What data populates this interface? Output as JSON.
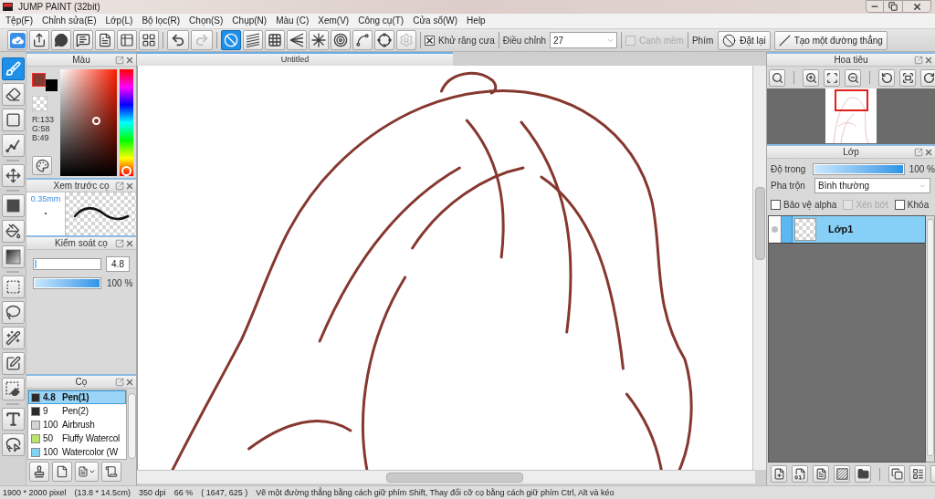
{
  "window": {
    "title": "JUMP PAINT (32bit)"
  },
  "menu": [
    "Tệp(F)",
    "Chỉnh sửa(E)",
    "Lớp(L)",
    "Bộ lọc(R)",
    "Chọn(S)",
    "Chụp(N)",
    "Màu (C)",
    "Xem(V)",
    "Công cụ(T)",
    "Cửa sổ(W)",
    "Help"
  ],
  "toolbar": {
    "history": [
      {
        "disabled": false
      },
      {
        "disabled": true
      }
    ],
    "rulers": [
      {
        "selected": true,
        "disabled": false
      },
      {
        "selected": false,
        "disabled": false
      },
      {
        "selected": false,
        "disabled": false
      },
      {
        "selected": false,
        "disabled": false
      },
      {
        "selected": false,
        "disabled": false
      },
      {
        "selected": false,
        "disabled": false
      },
      {
        "selected": false,
        "disabled": false
      },
      {
        "selected": false,
        "disabled": false
      },
      {
        "selected": false,
        "disabled": true
      }
    ],
    "antialias": {
      "label": "Khử răng cưa",
      "checked": true
    },
    "adjust": {
      "label": "Điều chỉnh",
      "value": "27"
    },
    "soft_edge": {
      "label": "Canh mềm",
      "checked": false,
      "disabled": true
    },
    "keys_label": "Phím",
    "buttons": [
      "Đặt lại",
      "Tạo một đường thẳng"
    ]
  },
  "tools": [
    {
      "selected": true
    },
    {
      "selected": false
    },
    {
      "selected": false
    },
    {
      "selected": false
    },
    {
      "selected": false
    },
    {
      "selected": false
    },
    {
      "selected": false
    },
    {
      "selected": false
    },
    {
      "selected": false
    },
    {
      "selected": false
    },
    {
      "selected": false
    },
    {
      "selected": false
    },
    {
      "selected": false
    },
    {
      "selected": false
    },
    {
      "selected": false
    }
  ],
  "color_panel": {
    "title": "Màu",
    "swatches": [
      {
        "kind": "background",
        "color": "#000000"
      },
      {
        "kind": "foreground",
        "color": "#853a31"
      }
    ],
    "readout": [
      "R:133",
      "G:58",
      "B:49"
    ],
    "hue_slider": {
      "level": 0.02
    }
  },
  "brush_preview": {
    "title": "Xem trước cọ",
    "size": "0.35mm"
  },
  "brush_control": {
    "title": "Kiểm soát cọ",
    "size": {
      "level": 0.03,
      "reading": "4.8"
    },
    "opacity": {
      "level": 1,
      "reading": "100 %"
    }
  },
  "brushes": {
    "title": "Cọ",
    "items": [
      {
        "size": "4.8",
        "name": "Pen(1)",
        "color": "#2b2b2b",
        "selected": true
      },
      {
        "size": "9",
        "name": "Pen(2)",
        "color": "#2b2b2b",
        "selected": false
      },
      {
        "size": "100",
        "name": "Airbrush",
        "color": "#d4d4d4",
        "selected": false
      },
      {
        "size": "50",
        "name": "Fluffy Watercol",
        "color": "#b8e36c",
        "selected": false
      },
      {
        "size": "100",
        "name": "Watercolor (W",
        "color": "#7fd4f2",
        "selected": false
      }
    ]
  },
  "document": {
    "tab": "Untitled"
  },
  "navigator": {
    "title": "Hoa tiêu"
  },
  "layers": {
    "title": "Lớp",
    "opacity": {
      "label": "Độ trong",
      "level": 1,
      "reading": "100 %"
    },
    "blend": {
      "label": "Pha trộn",
      "value": "Bình thường"
    },
    "options": [
      {
        "label": "Bảo vệ alpha",
        "checked": false,
        "disabled": false
      },
      {
        "label": "Xén bớt",
        "checked": false,
        "disabled": true
      },
      {
        "label": "Khóa",
        "checked": false,
        "disabled": false
      }
    ],
    "items": [
      {
        "name": "Lớp1",
        "selected": true
      }
    ]
  },
  "status_bar": [
    "1900 * 2000 pixel",
    "(13.8 * 14.5cm)",
    "350 dpi",
    "66 %",
    "( 1647, 625 )",
    "Vẽ một đường thẳng bằng cách giữ phím Shift, Thay đổi cỡ cọ bằng cách giữ phím Ctrl, Alt và kéo"
  ]
}
